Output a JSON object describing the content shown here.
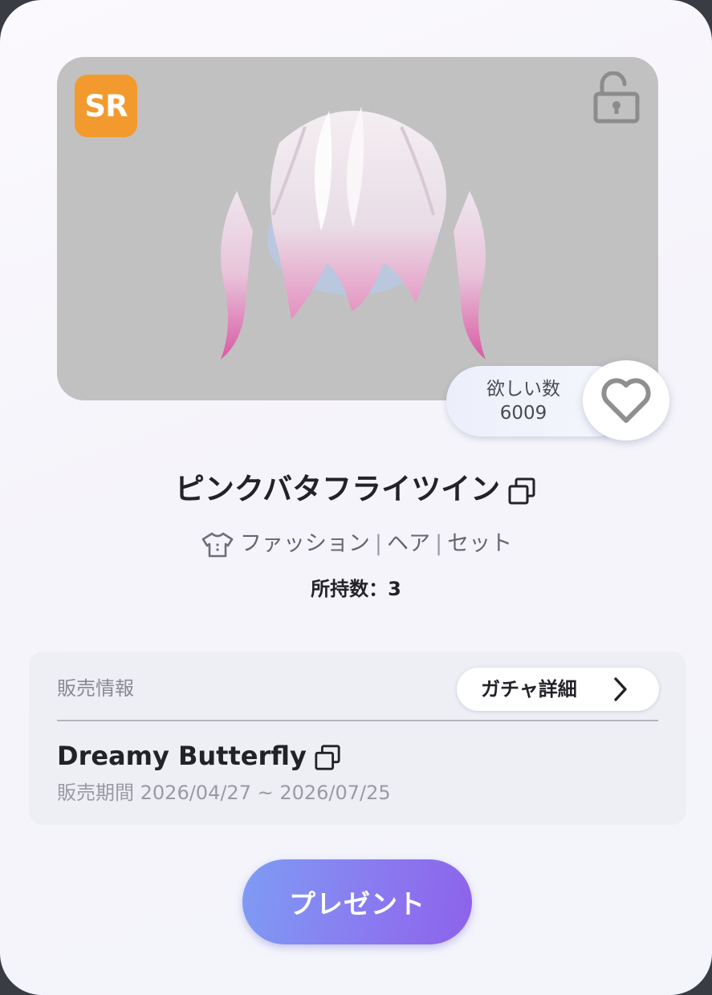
{
  "item": {
    "rarity": "SR",
    "name": "ピンクバタフライツイン",
    "categories": [
      "ファッション",
      "ヘア",
      "セット"
    ],
    "owned_text": "所持数：3"
  },
  "wishlist": {
    "label": "欲しい数",
    "count": "6009"
  },
  "sales": {
    "section_label": "販売情報",
    "gacha_button": "ガチャ詳細",
    "gacha_name": "Dreamy Butterfly",
    "period_label": "販売期間",
    "period_value": "2026/04/27 ~ 2026/07/25"
  },
  "actions": {
    "present_label": "プレゼント"
  },
  "icons": {
    "lock": "unlocked-padlock-icon",
    "heart": "heart-outline-icon",
    "copy": "copy-icon",
    "category": "shirt-icon",
    "chevron": "chevron-right-icon"
  },
  "colors": {
    "rarity_badge": "#f29a2e",
    "preview_bg": "#c1c1c1",
    "present_gradient_start": "#7e9cf4",
    "present_gradient_end": "#8d62ea"
  }
}
